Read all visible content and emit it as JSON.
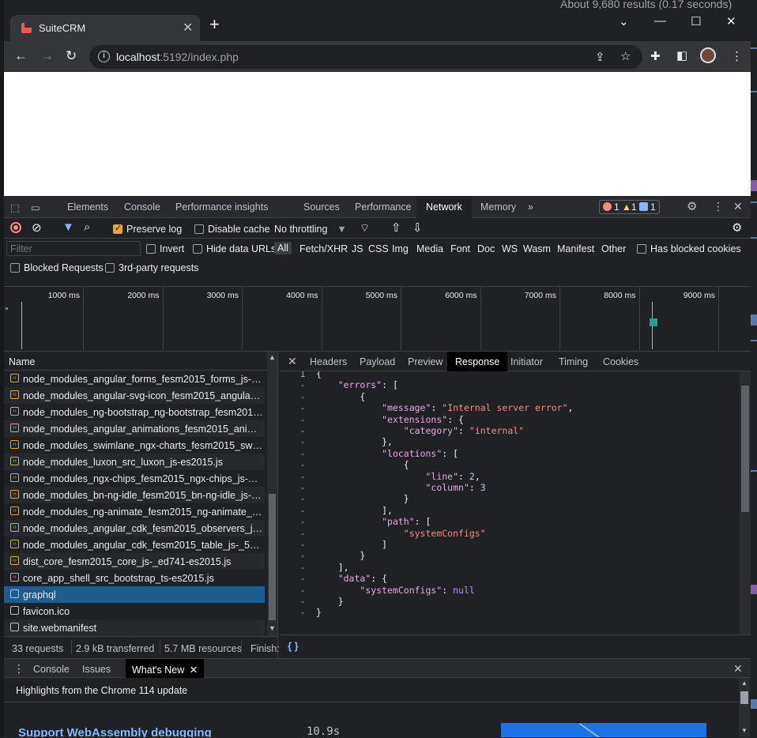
{
  "background_page": {
    "results_text": "About 9,680 results (0.17 seconds)",
    "below_text": "10.9s"
  },
  "browser": {
    "tab_title": "SuiteCRM",
    "tab_close": "✕",
    "new_tab": "+",
    "window_controls": [
      "⌄",
      "—",
      "☐",
      "✕"
    ],
    "url_host": "localhost",
    "url_rest": ":5192/index.php",
    "nav": {
      "back": "←",
      "forward": "→",
      "reload": "↻"
    }
  },
  "devtools": {
    "tabs": [
      "Elements",
      "Console",
      "Performance insights",
      "Sources",
      "Performance",
      "Network",
      "Memory"
    ],
    "active_tab": "Network",
    "more_tabs": "»",
    "errors": "1",
    "warnings": "1",
    "messages": "1",
    "toolbar": {
      "preserve_log": "Preserve log",
      "disable_cache": "Disable cache",
      "throttling": "No throttling"
    },
    "filter": {
      "placeholder": "Filter",
      "invert": "Invert",
      "hide_data_urls": "Hide data URLs",
      "types": [
        "All",
        "Fetch/XHR",
        "JS",
        "CSS",
        "Img",
        "Media",
        "Font",
        "Doc",
        "WS",
        "Wasm",
        "Manifest",
        "Other"
      ],
      "selected_type": "All",
      "has_blocked_cookies": "Has blocked cookies",
      "blocked_requests": "Blocked Requests",
      "third_party": "3rd-party requests"
    },
    "timeline_ticks": [
      "1000 ms",
      "2000 ms",
      "3000 ms",
      "4000 ms",
      "5000 ms",
      "6000 ms",
      "7000 ms",
      "8000 ms",
      "9000 ms"
    ],
    "name_header": "Name",
    "requests": [
      {
        "name": "node_modules_angular_forms_fesm2015_forms_js-_13c...",
        "type": "js"
      },
      {
        "name": "node_modules_angular-svg-icon_fesm2015_angular-sv...",
        "type": "js"
      },
      {
        "name": "node_modules_ng-bootstrap_ng-bootstrap_fesm2015_...",
        "type": "js"
      },
      {
        "name": "node_modules_angular_animations_fesm2015_animatio...",
        "type": "js"
      },
      {
        "name": "node_modules_swimlane_ngx-charts_fesm2015_swimla...",
        "type": "js"
      },
      {
        "name": "node_modules_luxon_src_luxon_js-es2015.js",
        "type": "js"
      },
      {
        "name": "node_modules_ngx-chips_fesm2015_ngx-chips_js-_c6cf...",
        "type": "js"
      },
      {
        "name": "node_modules_bn-ng-idle_fesm2015_bn-ng-idle_js-_c1...",
        "type": "js"
      },
      {
        "name": "node_modules_ng-animate_fesm2015_ng-animate_js-_...",
        "type": "js"
      },
      {
        "name": "node_modules_angular_cdk_fesm2015_observers_js-_20...",
        "type": "js"
      },
      {
        "name": "node_modules_angular_cdk_fesm2015_table_js-_50fc0-...",
        "type": "js"
      },
      {
        "name": "dist_core_fesm2015_core_js-_ed741-es2015.js",
        "type": "js"
      },
      {
        "name": "core_app_shell_src_bootstrap_ts-es2015.js",
        "type": "js"
      },
      {
        "name": "graphql",
        "type": "doc"
      },
      {
        "name": "favicon.ico",
        "type": "doc"
      },
      {
        "name": "site.webmanifest",
        "type": "doc"
      }
    ],
    "selected_request": "graphql",
    "summary": {
      "requests": "33 requests",
      "transferred": "2.9 kB transferred",
      "resources": "5.7 MB resources",
      "finish": "Finish:"
    },
    "detail_tabs": [
      "Headers",
      "Payload",
      "Preview",
      "Response",
      "Initiator",
      "Timing",
      "Cookies"
    ],
    "active_detail_tab": "Response",
    "response_lines": [
      {
        "gutter": "1",
        "html": "{"
      },
      {
        "gutter": "-",
        "html": "    <span class='k'>\"errors\"</span>: ["
      },
      {
        "gutter": "-",
        "html": "        {"
      },
      {
        "gutter": "-",
        "html": "            <span class='k'>\"message\"</span>: <span class='s'>\"Internal server error\"</span>,"
      },
      {
        "gutter": "-",
        "html": "            <span class='k'>\"extensions\"</span>: {"
      },
      {
        "gutter": "-",
        "html": "                <span class='k'>\"category\"</span>: <span class='s'>\"internal\"</span>"
      },
      {
        "gutter": "-",
        "html": "            },"
      },
      {
        "gutter": "-",
        "html": "            <span class='k'>\"locations\"</span>: ["
      },
      {
        "gutter": "-",
        "html": "                {"
      },
      {
        "gutter": "-",
        "html": "                    <span class='k'>\"line\"</span>: <span class='n'>2</span>,"
      },
      {
        "gutter": "-",
        "html": "                    <span class='k'>\"column\"</span>: <span class='n'>3</span>"
      },
      {
        "gutter": "-",
        "html": "                }"
      },
      {
        "gutter": "-",
        "html": "            ],"
      },
      {
        "gutter": "-",
        "html": "            <span class='k'>\"path\"</span>: ["
      },
      {
        "gutter": "-",
        "html": "                <span class='s'>\"systemConfigs\"</span>"
      },
      {
        "gutter": "-",
        "html": "            ]"
      },
      {
        "gutter": "-",
        "html": "        }"
      },
      {
        "gutter": "-",
        "html": "    ],"
      },
      {
        "gutter": "-",
        "html": "    <span class='k'>\"data\"</span>: {"
      },
      {
        "gutter": "-",
        "html": "        <span class='k'>\"systemConfigs\"</span>: <span class='nl'>null</span>"
      },
      {
        "gutter": "-",
        "html": "    }"
      },
      {
        "gutter": "-",
        "html": "}"
      }
    ],
    "format_button": "{ }",
    "drawer": {
      "tabs": [
        "Console",
        "Issues",
        "What's New"
      ],
      "active_tab": "What's New",
      "highlight": "Highlights from the Chrome 114 update",
      "feature_title": "Support WebAssembly debugging"
    }
  }
}
